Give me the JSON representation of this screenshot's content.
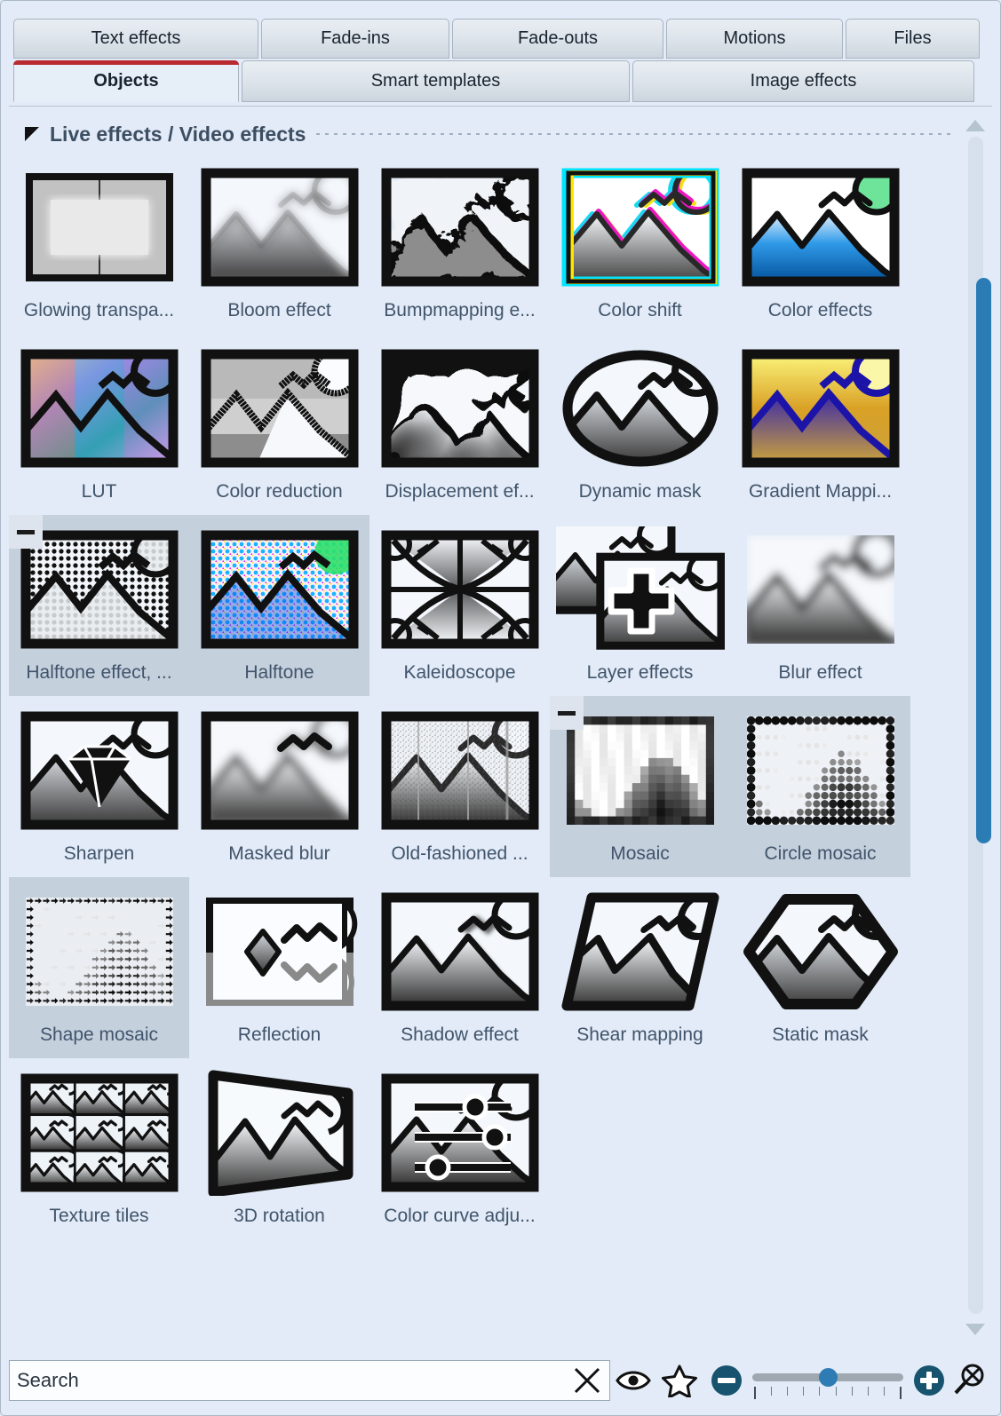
{
  "tabs_row1": [
    {
      "label": "Text effects",
      "key": "t-texteffects"
    },
    {
      "label": "Fade-ins",
      "key": "t-fadeins"
    },
    {
      "label": "Fade-outs",
      "key": "t-fadeouts"
    },
    {
      "label": "Motions",
      "key": "t-motions"
    },
    {
      "label": "Files",
      "key": "t-files"
    }
  ],
  "tabs_row2": [
    {
      "label": "Objects",
      "key": "t-objects",
      "active": true
    },
    {
      "label": "Smart templates",
      "key": "t-smart",
      "active": false
    },
    {
      "label": "Image effects",
      "key": "t-image",
      "active": false
    }
  ],
  "group": {
    "title": "Live effects / Video effects",
    "collapse_icon": "triangle-collapse-icon",
    "expanded": true
  },
  "grid": {
    "columns": 5,
    "rows": [
      [
        {
          "label": "Glowing transpa...",
          "icon": "glowing-transparency-thumb",
          "selected": false
        },
        {
          "label": "Bloom effect",
          "icon": "bloom-effect-thumb",
          "selected": false
        },
        {
          "label": "Bumpmapping e...",
          "icon": "bumpmapping-thumb",
          "selected": false
        },
        {
          "label": "Color shift",
          "icon": "color-shift-thumb",
          "selected": false
        },
        {
          "label": "Color effects",
          "icon": "color-effects-thumb",
          "selected": false
        }
      ],
      [
        {
          "label": "LUT",
          "icon": "lut-thumb",
          "selected": false
        },
        {
          "label": "Color reduction",
          "icon": "color-reduction-thumb",
          "selected": false
        },
        {
          "label": "Displacement ef...",
          "icon": "displacement-thumb",
          "selected": false
        },
        {
          "label": "Dynamic mask",
          "icon": "dynamic-mask-thumb",
          "selected": false
        },
        {
          "label": "Gradient Mappi...",
          "icon": "gradient-mapping-thumb",
          "selected": false
        }
      ],
      [
        {
          "label": "Halftone effect, ...",
          "icon": "halftone-mono-thumb",
          "selected": true,
          "badge": "minus"
        },
        {
          "label": "Halftone",
          "icon": "halftone-color-thumb",
          "selected": true
        },
        {
          "label": "Kaleidoscope",
          "icon": "kaleidoscope-thumb",
          "selected": false
        },
        {
          "label": "Layer effects",
          "icon": "layer-effects-thumb",
          "selected": false
        },
        {
          "label": "Blur effect",
          "icon": "blur-effect-thumb",
          "selected": false
        }
      ],
      [
        {
          "label": "Sharpen",
          "icon": "sharpen-thumb",
          "selected": false
        },
        {
          "label": "Masked blur",
          "icon": "masked-blur-thumb",
          "selected": false
        },
        {
          "label": "Old-fashioned ...",
          "icon": "old-fashioned-thumb",
          "selected": false
        },
        {
          "label": "Mosaic",
          "icon": "mosaic-thumb",
          "selected": true,
          "badge": "minus"
        },
        {
          "label": "Circle mosaic",
          "icon": "circle-mosaic-thumb",
          "selected": true
        }
      ],
      [
        {
          "label": "Shape mosaic",
          "icon": "shape-mosaic-thumb",
          "selected": true
        },
        {
          "label": "Reflection",
          "icon": "reflection-thumb",
          "selected": false
        },
        {
          "label": "Shadow effect",
          "icon": "shadow-effect-thumb",
          "selected": false
        },
        {
          "label": "Shear mapping",
          "icon": "shear-mapping-thumb",
          "selected": false
        },
        {
          "label": "Static mask",
          "icon": "static-mask-thumb",
          "selected": false
        }
      ],
      [
        {
          "label": "Texture tiles",
          "icon": "texture-tiles-thumb",
          "selected": false
        },
        {
          "label": "3D rotation",
          "icon": "rotation-3d-thumb",
          "selected": false
        },
        {
          "label": "Color curve adju...",
          "icon": "color-curve-thumb",
          "selected": false
        }
      ]
    ]
  },
  "scrollbar": {
    "up_icon": "scroll-up-arrow-icon",
    "down_icon": "scroll-down-arrow-icon",
    "thumb_top_pct": 12,
    "thumb_height_pct": 48
  },
  "bottombar": {
    "search": {
      "value": "",
      "placeholder": "Search",
      "clear_icon": "clear-x-icon"
    },
    "preview_icon": "eye-icon",
    "favorite_icon": "star-icon",
    "zoom_out_icon": "minus-circle-icon",
    "zoom_in_icon": "plus-circle-icon",
    "reset_zoom_icon": "magnifier-x-icon",
    "zoom_slider_value": 50
  },
  "colors": {
    "panel_bg": "#e2ebf7",
    "selection_bg": "#c5d0dd",
    "accent_red": "#b9292f",
    "accent_blue": "#2b7cb5",
    "label_text": "#41546b"
  }
}
